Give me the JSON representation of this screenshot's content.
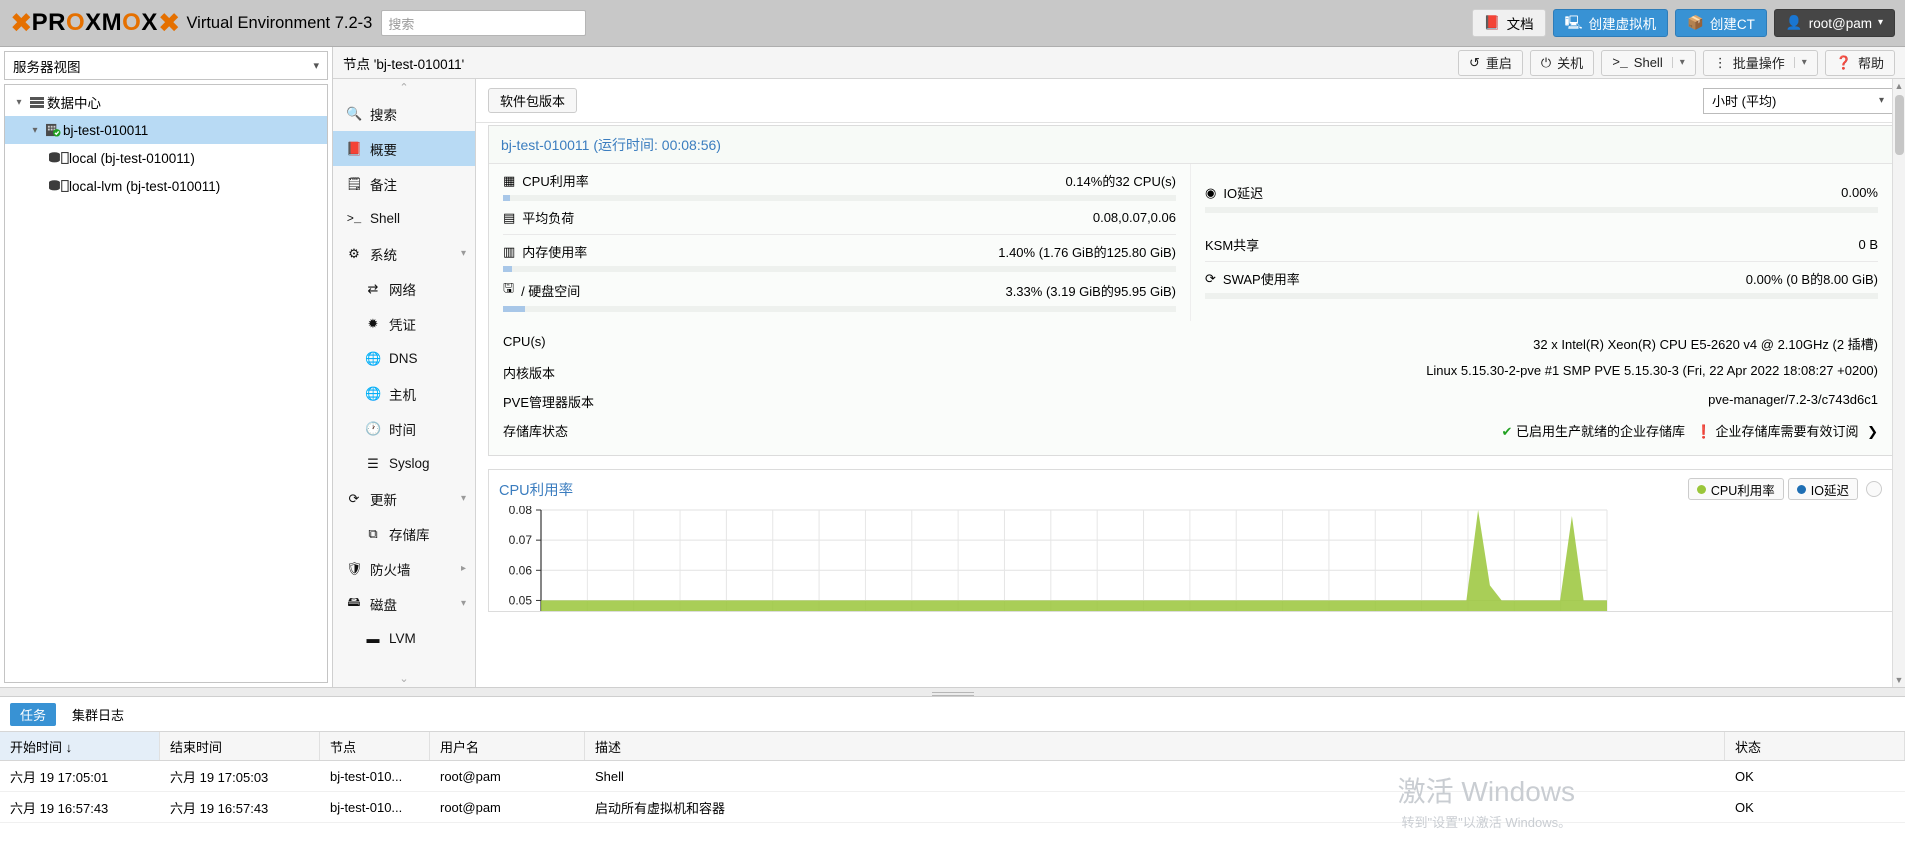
{
  "header": {
    "logo_text": "PROXMOX",
    "product": "Virtual Environment 7.2-3",
    "search_placeholder": "搜索",
    "buttons": [
      {
        "label": "文档",
        "icon": "book-icon",
        "style": "light"
      },
      {
        "label": "创建虚拟机",
        "icon": "monitor-icon",
        "style": "blue"
      },
      {
        "label": "创建CT",
        "icon": "cube-icon",
        "style": "blue"
      },
      {
        "label": "root@pam",
        "icon": "user-icon",
        "style": "dark"
      }
    ]
  },
  "sidebar": {
    "view_label": "服务器视图",
    "tree": [
      {
        "label": "数据中心",
        "icon": "datacenter-icon",
        "depth": 0,
        "selected": false,
        "expander": "▾"
      },
      {
        "label": "bj-test-010011",
        "icon": "server-icon",
        "depth": 1,
        "selected": true,
        "expander": "▾"
      },
      {
        "label": "local (bj-test-010011)",
        "icon": "storage-icon",
        "depth": 2,
        "selected": false,
        "expander": ""
      },
      {
        "label": "local-lvm (bj-test-010011)",
        "icon": "storage-icon",
        "depth": 2,
        "selected": false,
        "expander": ""
      }
    ]
  },
  "breadcrumb": {
    "text": "节点 'bj-test-010011'",
    "actions": [
      {
        "label": "重启",
        "icon": "restart-icon",
        "dropdown": false
      },
      {
        "label": "关机",
        "icon": "power-icon",
        "dropdown": false
      },
      {
        "label": "Shell",
        "icon": "shell-icon",
        "dropdown": true
      },
      {
        "label": "批量操作",
        "icon": "kebab-icon",
        "dropdown": true
      },
      {
        "label": "帮助",
        "icon": "help-icon",
        "dropdown": false
      }
    ]
  },
  "nav": {
    "items": [
      {
        "label": "搜索",
        "icon": "search-icon",
        "sub": false,
        "selected": false,
        "arrow": ""
      },
      {
        "label": "概要",
        "icon": "book-icon",
        "sub": false,
        "selected": true,
        "arrow": ""
      },
      {
        "label": "备注",
        "icon": "note-icon",
        "sub": false,
        "selected": false,
        "arrow": ""
      },
      {
        "label": "Shell",
        "icon": "shell-icon",
        "sub": false,
        "selected": false,
        "arrow": ""
      },
      {
        "label": "系统",
        "icon": "gear-icon",
        "sub": false,
        "selected": false,
        "arrow": "▾"
      },
      {
        "label": "网络",
        "icon": "network-icon",
        "sub": true,
        "selected": false,
        "arrow": ""
      },
      {
        "label": "凭证",
        "icon": "certificate-icon",
        "sub": true,
        "selected": false,
        "arrow": ""
      },
      {
        "label": "DNS",
        "icon": "globe-icon",
        "sub": true,
        "selected": false,
        "arrow": ""
      },
      {
        "label": "主机",
        "icon": "globe-icon",
        "sub": true,
        "selected": false,
        "arrow": ""
      },
      {
        "label": "时间",
        "icon": "clock-icon",
        "sub": true,
        "selected": false,
        "arrow": ""
      },
      {
        "label": "Syslog",
        "icon": "list-icon",
        "sub": true,
        "selected": false,
        "arrow": ""
      },
      {
        "label": "更新",
        "icon": "refresh-icon",
        "sub": false,
        "selected": false,
        "arrow": "▾"
      },
      {
        "label": "存储库",
        "icon": "repository-icon",
        "sub": true,
        "selected": false,
        "arrow": ""
      },
      {
        "label": "防火墙",
        "icon": "shield-icon",
        "sub": false,
        "selected": false,
        "arrow": "▸"
      },
      {
        "label": "磁盘",
        "icon": "disk-icon",
        "sub": false,
        "selected": false,
        "arrow": "▾"
      },
      {
        "label": "LVM",
        "icon": "lvm-icon",
        "sub": true,
        "selected": false,
        "arrow": ""
      }
    ]
  },
  "toolbar": {
    "package_versions_label": "软件包版本",
    "timeframe_value": "小时 (平均)"
  },
  "status": {
    "title": "bj-test-010011 (运行时间: 00:08:56)",
    "left": [
      {
        "label": "CPU利用率",
        "icon": "cpu-icon",
        "value": "0.14%的32 CPU(s)",
        "bar_pct": 0.14,
        "has_bar": true
      },
      {
        "label": "平均负荷",
        "icon": "load-icon",
        "value": "0.08,0.07,0.06",
        "bar_pct": 0,
        "has_bar": false
      },
      {
        "label": "内存使用率",
        "icon": "memory-icon",
        "value": "1.40% (1.76 GiB的125.80 GiB)",
        "bar_pct": 1.4,
        "has_bar": true
      },
      {
        "label": "/ 硬盘空间",
        "icon": "harddisk-icon",
        "value": "3.33% (3.19 GiB的95.95 GiB)",
        "bar_pct": 3.33,
        "has_bar": true
      }
    ],
    "right": [
      {
        "label": "IO延迟",
        "icon": "iodelay-icon",
        "value": "0.00%",
        "bar_pct": 0,
        "has_bar": true
      },
      {
        "label": "",
        "icon": "",
        "value": "",
        "bar_pct": 0,
        "has_bar": false
      },
      {
        "label": "KSM共享",
        "icon": "",
        "value": "0 B",
        "bar_pct": 0,
        "has_bar": false
      },
      {
        "label": "SWAP使用率",
        "icon": "swap-icon",
        "value": "0.00% (0 B的8.00 GiB)",
        "bar_pct": 0,
        "has_bar": true
      }
    ],
    "info": [
      {
        "key": "CPU(s)",
        "value": "32 x Intel(R) Xeon(R) CPU E5-2620 v4 @ 2.10GHz (2 插槽)"
      },
      {
        "key": "内核版本",
        "value": "Linux 5.15.30-2-pve #1 SMP PVE 5.15.30-3 (Fri, 22 Apr 2022 18:08:27 +0200)"
      },
      {
        "key": "PVE管理器版本",
        "value": "pve-manager/7.2-3/c743d6c1"
      }
    ],
    "repo_key": "存储库状态",
    "repo_ok": "已启用生产就绪的企业存储库",
    "repo_warn": "企业存储库需要有效订阅",
    "repo_arrow": "❯"
  },
  "chart_data": {
    "type": "line",
    "title": "CPU利用率",
    "xlabel": "",
    "ylabel": "",
    "ylim": [
      0.05,
      0.08
    ],
    "yticks": [
      "0.08",
      "0.07",
      "0.06",
      "0.05"
    ],
    "grid": true,
    "legend_position": "top-right",
    "series": [
      {
        "name": "CPU利用率",
        "color": "#9ac63a",
        "values": [
          0.05,
          0.05,
          0.05,
          0.05,
          0.05,
          0.05,
          0.05,
          0.05,
          0.05,
          0.05,
          0.05,
          0.05,
          0.05,
          0.05,
          0.05,
          0.05,
          0.05,
          0.05,
          0.05,
          0.05,
          0.05,
          0.05,
          0.05,
          0.05,
          0.05,
          0.05,
          0.05,
          0.05,
          0.05,
          0.05,
          0.05,
          0.05,
          0.05,
          0.05,
          0.05,
          0.05,
          0.05,
          0.05,
          0.05,
          0.05,
          0.05,
          0.05,
          0.05,
          0.05,
          0.05,
          0.05,
          0.05,
          0.05,
          0.05,
          0.05,
          0.05,
          0.05,
          0.05,
          0.05,
          0.05,
          0.05,
          0.05,
          0.05,
          0.05,
          0.05,
          0.05,
          0.05,
          0.05,
          0.05,
          0.05,
          0.05,
          0.05,
          0.05,
          0.05,
          0.05,
          0.05,
          0.05,
          0.05,
          0.05,
          0.05,
          0.05,
          0.05,
          0.05,
          0.05,
          0.05,
          0.08,
          0.055,
          0.05,
          0.05,
          0.05,
          0.05,
          0.05,
          0.05,
          0.078,
          0.05,
          0.05,
          0.05
        ]
      },
      {
        "name": "IO延迟",
        "color": "#1f6fb4",
        "values": [
          0,
          0,
          0,
          0,
          0,
          0,
          0,
          0,
          0,
          0,
          0,
          0,
          0,
          0,
          0,
          0,
          0,
          0,
          0,
          0,
          0,
          0,
          0,
          0,
          0,
          0,
          0,
          0,
          0,
          0,
          0,
          0,
          0,
          0,
          0,
          0,
          0,
          0,
          0,
          0,
          0,
          0,
          0,
          0,
          0,
          0,
          0,
          0,
          0,
          0,
          0,
          0,
          0,
          0,
          0,
          0,
          0,
          0,
          0,
          0,
          0,
          0,
          0,
          0,
          0,
          0,
          0,
          0,
          0,
          0,
          0,
          0,
          0,
          0,
          0,
          0,
          0,
          0,
          0,
          0,
          0,
          0,
          0,
          0,
          0,
          0,
          0,
          0,
          0,
          0,
          0,
          0
        ]
      }
    ],
    "legend": [
      {
        "label": "CPU利用率",
        "color": "#9ac63a"
      },
      {
        "label": "IO延迟",
        "color": "#1f6fb4"
      }
    ]
  },
  "bottom": {
    "tabs": [
      {
        "label": "任务",
        "active": true
      },
      {
        "label": "集群日志",
        "active": false
      }
    ],
    "columns": [
      "开始时间 ↓",
      "结束时间",
      "节点",
      "用户名",
      "描述",
      "状态"
    ],
    "rows": [
      {
        "start": "六月 19 17:05:01",
        "end": "六月 19 17:05:03",
        "node": "bj-test-010...",
        "user": "root@pam",
        "desc": "Shell",
        "status": "OK"
      },
      {
        "start": "六月 19 16:57:43",
        "end": "六月 19 16:57:43",
        "node": "bj-test-010...",
        "user": "root@pam",
        "desc": "启动所有虚拟机和容器",
        "status": "OK"
      }
    ]
  },
  "watermark": {
    "line1": "激活 Windows",
    "line2": "转到\"设置\"以激活 Windows。"
  }
}
